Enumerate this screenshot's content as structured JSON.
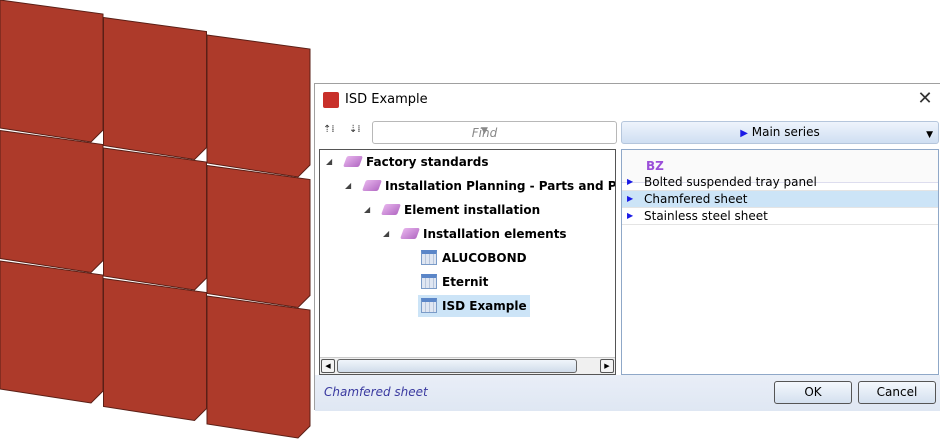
{
  "viewport": {
    "panel_color": "#ad3a2a",
    "panel_edge": "#5a1f16"
  },
  "dialog": {
    "title": "ISD Example",
    "close_glyph": "✕",
    "toolbar": {
      "find_placeholder": "Find",
      "series_label": "Main series"
    },
    "tree": [
      {
        "label": "Factory standards",
        "icon": "book-icon",
        "level": 0
      },
      {
        "label": "Installation Planning - Parts and Processing",
        "icon": "book-icon",
        "level": 1
      },
      {
        "label": "Element installation",
        "icon": "book-icon",
        "level": 2
      },
      {
        "label": "Installation elements",
        "icon": "book-icon",
        "level": 3
      },
      {
        "label": "ALUCOBOND",
        "icon": "table-icon",
        "level": 4
      },
      {
        "label": "Eternit",
        "icon": "table-icon",
        "level": 4
      },
      {
        "label": "ISD Example",
        "icon": "table-icon",
        "level": 4,
        "selected": true
      }
    ],
    "grid": {
      "column": "BZ",
      "rows": [
        "Bolted suspended tray panel",
        "Chamfered sheet",
        "Stainless steel sheet"
      ],
      "selected_row": 1
    },
    "status": "Chamfered sheet",
    "ok_label": "OK",
    "cancel_label": "Cancel"
  }
}
